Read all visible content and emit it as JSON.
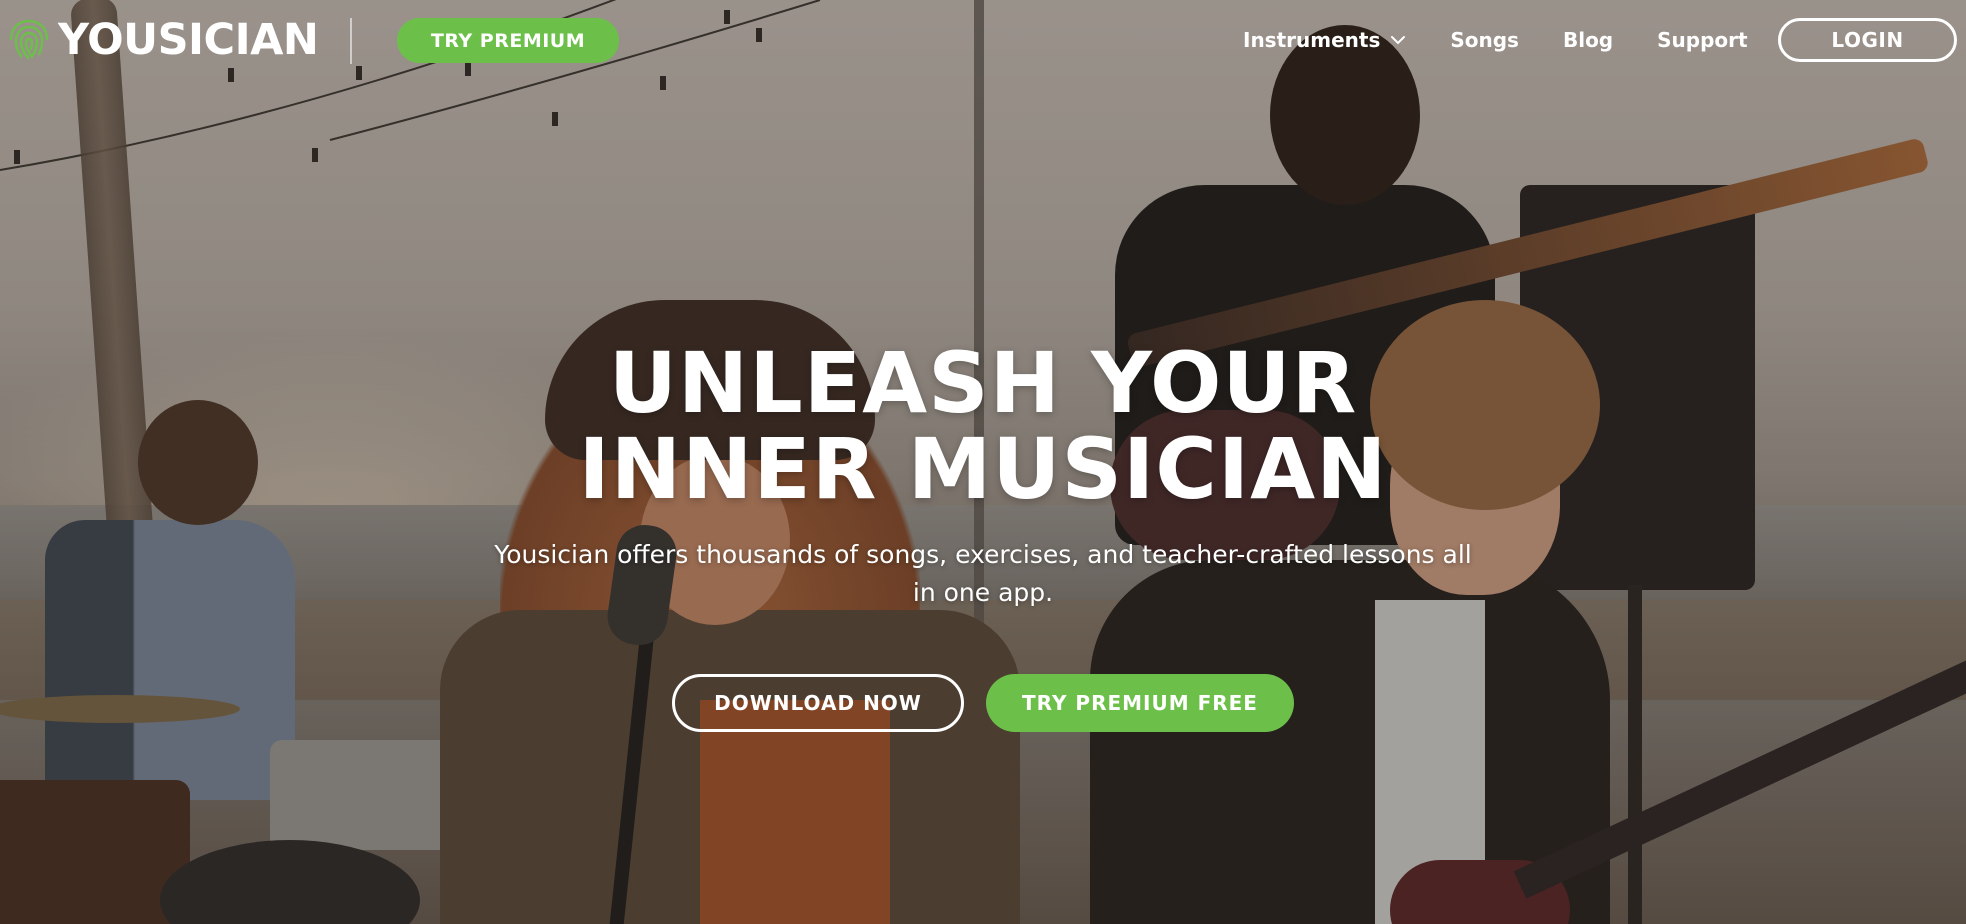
{
  "header": {
    "logo_text": "YOUSICIAN",
    "try_premium_label": "TRY PREMIUM",
    "nav": [
      {
        "label": "Instruments",
        "has_dropdown": true
      },
      {
        "label": "Songs"
      },
      {
        "label": "Blog"
      },
      {
        "label": "Support"
      }
    ],
    "login_label": "LOGIN"
  },
  "hero": {
    "headline_line1": "UNLEASH YOUR",
    "headline_line2": "INNER MUSICIAN",
    "subline": "Yousician offers thousands of songs, exercises, and teacher-crafted lessons all in one app.",
    "download_label": "DOWNLOAD NOW",
    "try_premium_free_label": "TRY PREMIUM FREE"
  },
  "colors": {
    "accent_green": "#6cc04a",
    "text_white": "#ffffff"
  },
  "icons": {
    "logo": "fingerprint-logo-icon",
    "dropdown": "chevron-down-icon"
  }
}
